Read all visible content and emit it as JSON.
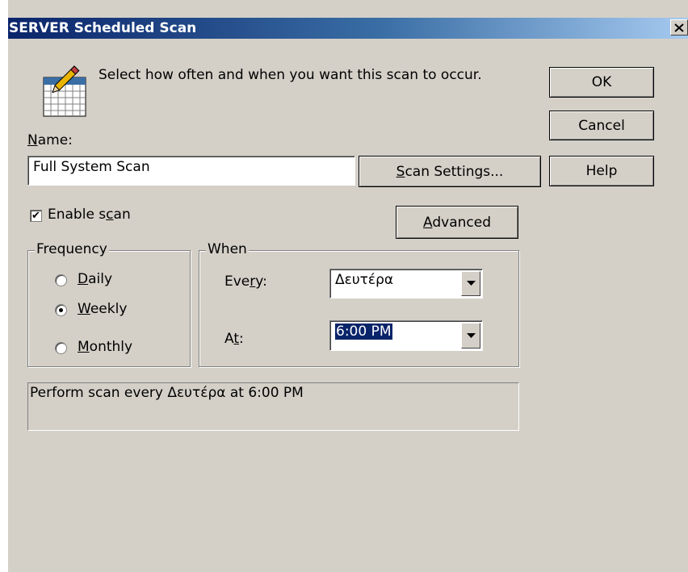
{
  "window": {
    "title": "SERVER Scheduled Scan",
    "close_glyph": "✕"
  },
  "header": {
    "icon": "calendar-pencil-icon",
    "instruction": "Select how often and when you want this scan to occur."
  },
  "buttons": {
    "ok": "OK",
    "cancel": "Cancel",
    "help": "Help",
    "scan_settings": {
      "pre": "",
      "u": "S",
      "post": "can Settings..."
    },
    "advanced": {
      "pre": "",
      "u": "A",
      "post": "dvanced"
    }
  },
  "name": {
    "label_pre": "",
    "label_u": "N",
    "label_post": "ame:",
    "value": "Full System Scan"
  },
  "enable_scan": {
    "checked": true,
    "check_glyph": "✔",
    "label_pre": "Enable s",
    "label_u": "c",
    "label_post": "an"
  },
  "frequency": {
    "legend": "Frequency",
    "options": [
      {
        "pre": "",
        "u": "D",
        "post": "aily",
        "selected": false
      },
      {
        "pre": "",
        "u": "W",
        "post": "eekly",
        "selected": true
      },
      {
        "pre": "",
        "u": "M",
        "post": "onthly",
        "selected": false
      }
    ]
  },
  "when": {
    "legend": "When",
    "every": {
      "label_pre": "Eve",
      "label_u": "r",
      "label_post": "y:",
      "value": "Δευτέρα"
    },
    "at": {
      "label_pre": "A",
      "label_u": "t",
      "label_post": ":",
      "value": "6:00 PM"
    }
  },
  "summary": "Perform scan every Δευτέρα at 6:00 PM"
}
